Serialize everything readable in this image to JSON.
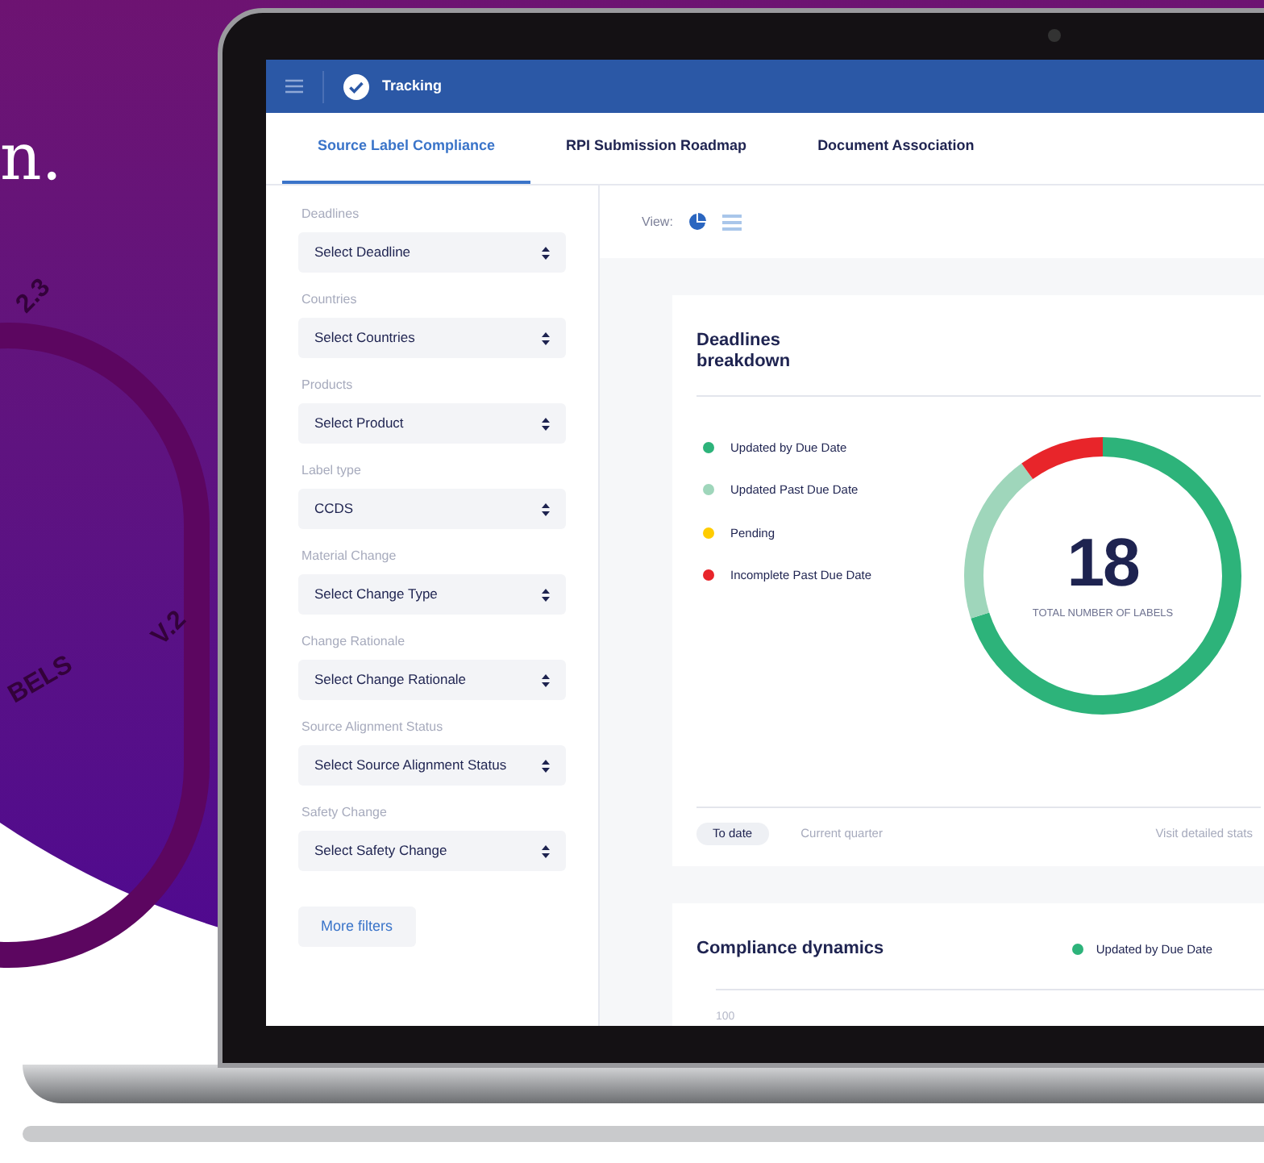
{
  "backdrop": {
    "headline_fragment": "n.",
    "decor_texts": [
      "2.3",
      "BELS",
      "V.2"
    ]
  },
  "app": {
    "title": "Tracking",
    "tabs": [
      {
        "label": "Source Label Compliance",
        "selected": true
      },
      {
        "label": "RPI Submission Roadmap",
        "selected": false
      },
      {
        "label": "Document Association",
        "selected": false
      }
    ],
    "filters": [
      {
        "label": "Deadlines",
        "value": "Select Deadline"
      },
      {
        "label": "Countries",
        "value": "Select Countries"
      },
      {
        "label": "Products",
        "value": "Select Product"
      },
      {
        "label": "Label type",
        "value": "CCDS"
      },
      {
        "label": "Material Change",
        "value": "Select Change Type"
      },
      {
        "label": "Change Rationale",
        "value": "Select Change Rationale"
      },
      {
        "label": "Source Alignment Status",
        "value": "Select Source Alignment Status"
      },
      {
        "label": "Safety Change",
        "value": "Select Safety Change"
      }
    ],
    "more_filters": "More filters",
    "view": {
      "label": "View:",
      "options": [
        {
          "kind": "chart",
          "selected": true
        },
        {
          "kind": "list",
          "selected": false
        }
      ]
    },
    "breakdown": {
      "title": "Deadlines breakdown",
      "legend": [
        {
          "label": "Updated by Due Date",
          "color": "#2db37a"
        },
        {
          "label": "Updated Past Due Date",
          "color": "#9fd6bb"
        },
        {
          "label": "Pending",
          "color": "#ffcc00"
        },
        {
          "label": "Incomplete Past Due Date",
          "color": "#e8252a"
        }
      ],
      "total": "18",
      "total_caption": "TOTAL NUMBER OF LABELS",
      "periods": [
        {
          "label": "To date",
          "selected": true
        },
        {
          "label": "Current quarter",
          "selected": false
        }
      ],
      "stats_link": "Visit detailed stats"
    },
    "dynamics": {
      "title": "Compliance dynamics",
      "legend": [
        {
          "label": "Updated by Due Date",
          "color": "#2db37a"
        }
      ],
      "axis_label": "100"
    }
  }
}
